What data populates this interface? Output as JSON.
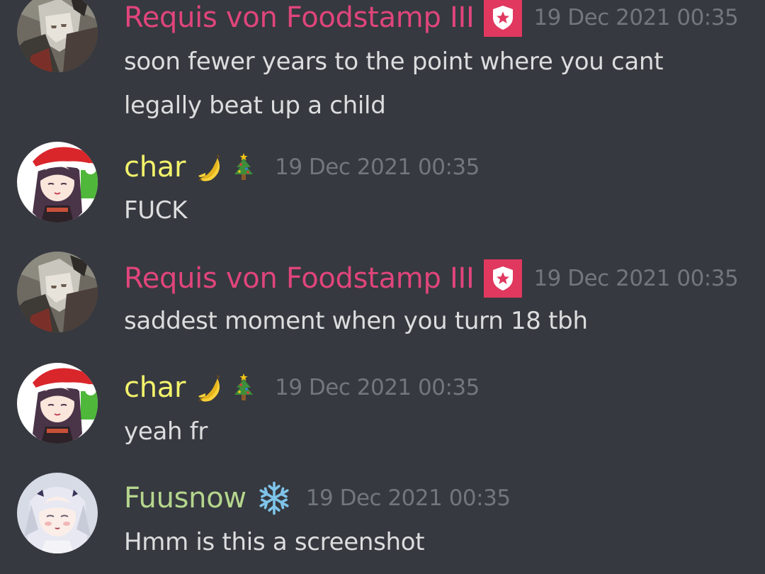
{
  "colors": {
    "background": "#36393f",
    "requis_name": "#e0457b",
    "char_name": "#f3f36b",
    "fuusnow_name": "#b5d68e",
    "timestamp": "#72767d",
    "text": "#dcddde",
    "badge": "#e0385f"
  },
  "messages": [
    {
      "username": "Requis von Foodstamp III",
      "badge_icon": "shield-star-icon",
      "timestamp": "19 Dec 2021 00:35",
      "lines": [
        "soon fewer years to the point where you cant",
        "legally beat up a child"
      ],
      "avatar": "requis-avatar"
    },
    {
      "username": "char",
      "emoji_icons": [
        "banana-emoji-icon",
        "christmas-tree-emoji-icon"
      ],
      "timestamp": "19 Dec 2021 00:35",
      "lines": [
        "FUCK"
      ],
      "avatar": "char-avatar"
    },
    {
      "username": "Requis von Foodstamp III",
      "badge_icon": "shield-star-icon",
      "timestamp": "19 Dec 2021 00:35",
      "lines": [
        "saddest moment when you turn 18 tbh"
      ],
      "avatar": "requis-avatar"
    },
    {
      "username": "char",
      "emoji_icons": [
        "banana-emoji-icon",
        "christmas-tree-emoji-icon"
      ],
      "timestamp": "19 Dec 2021 00:35",
      "lines": [
        "yeah fr"
      ],
      "avatar": "char-avatar"
    },
    {
      "username": "Fuusnow",
      "emoji_icons": [
        "snowflake-emoji-icon"
      ],
      "timestamp": "19 Dec 2021 00:35",
      "lines": [
        "Hmm is this a screenshot"
      ],
      "avatar": "fuusnow-avatar"
    }
  ]
}
